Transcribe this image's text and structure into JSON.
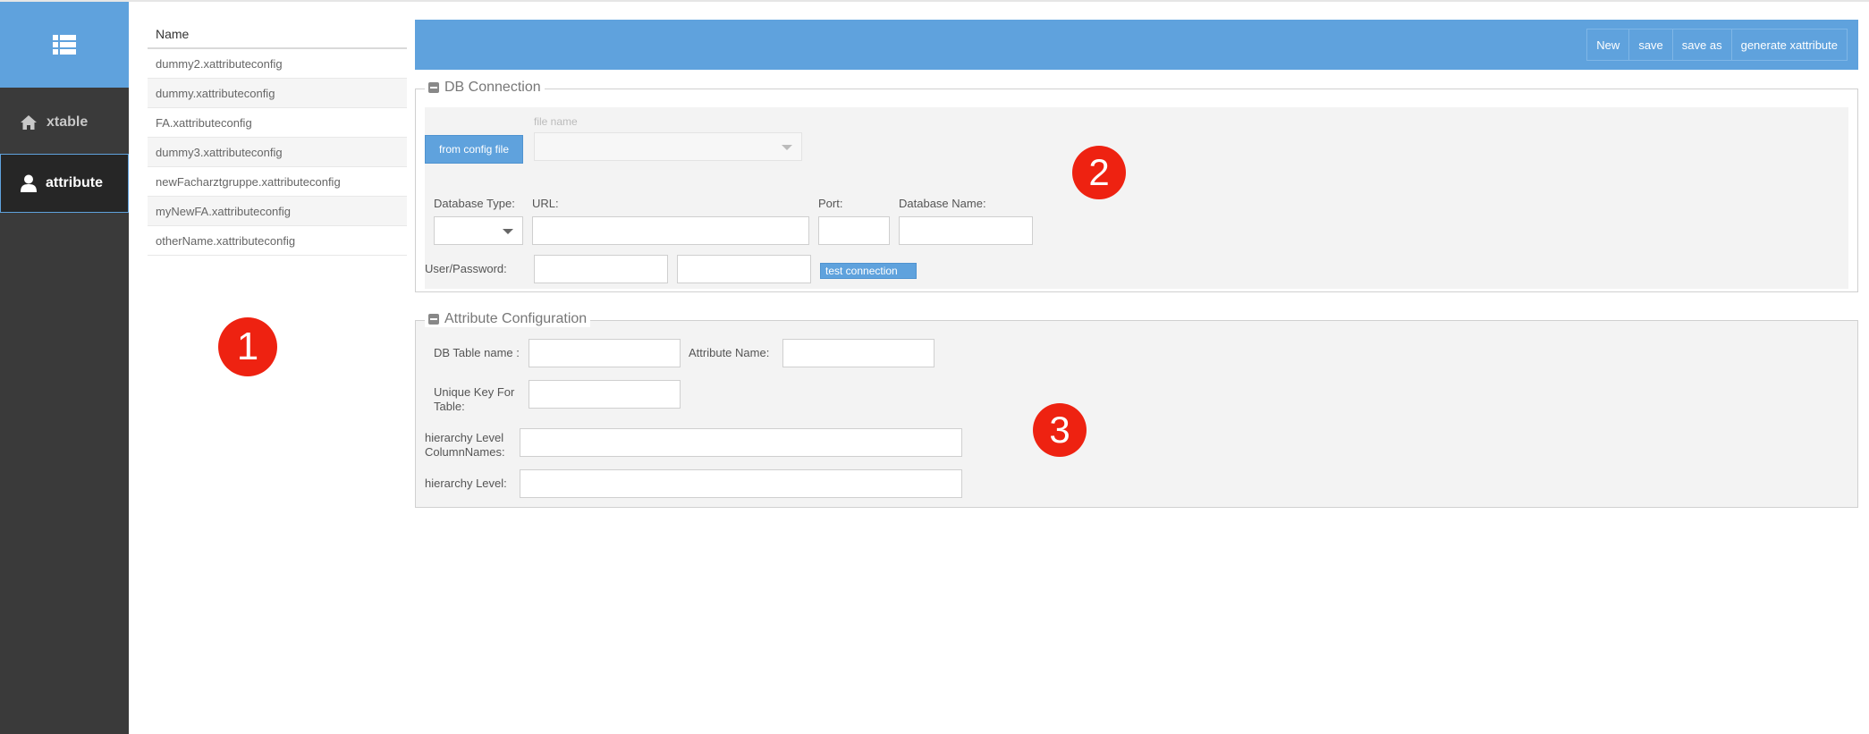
{
  "sidebar": {
    "header_icon": "list-icon",
    "items": [
      {
        "label": "xtable",
        "icon": "home-icon"
      },
      {
        "label": "attribute",
        "icon": "user-icon"
      }
    ]
  },
  "filelist": {
    "header": "Name",
    "files": [
      "dummy2.xattributeconfig",
      "dummy.xattributeconfig",
      "FA.xattributeconfig",
      "dummy3.xattributeconfig",
      "newFacharztgruppe.xattributeconfig",
      "myNewFA.xattributeconfig",
      "otherName.xattributeconfig"
    ]
  },
  "toolbar": {
    "new_label": "New",
    "save_label": "save",
    "save_as_label": "save as",
    "generate_label": "generate xattribute"
  },
  "db_connection": {
    "title": "DB Connection",
    "from_config_label": "from config file",
    "file_name_label": "file name",
    "database_type_label": "Database Type:",
    "url_label": "URL:",
    "port_label": "Port:",
    "database_name_label": "Database Name:",
    "user_password_label": "User/Password:",
    "test_connection_label": "test connection"
  },
  "attribute_config": {
    "title": "Attribute Configuration",
    "db_table_name_label": "DB Table name :",
    "attribute_name_label": "Attribute Name:",
    "unique_key_label_1": "Unique Key For",
    "unique_key_label_2": "Table:",
    "hierarchy_columns_label_1": "hierarchy Level",
    "hierarchy_columns_label_2": "ColumnNames:",
    "hierarchy_level_label": "hierarchy Level:"
  },
  "badges": {
    "one": "1",
    "two": "2",
    "three": "3"
  },
  "colors": {
    "accent": "#5fa2dd",
    "sidebar": "#3a3a3a",
    "badge": "#ee2211"
  }
}
